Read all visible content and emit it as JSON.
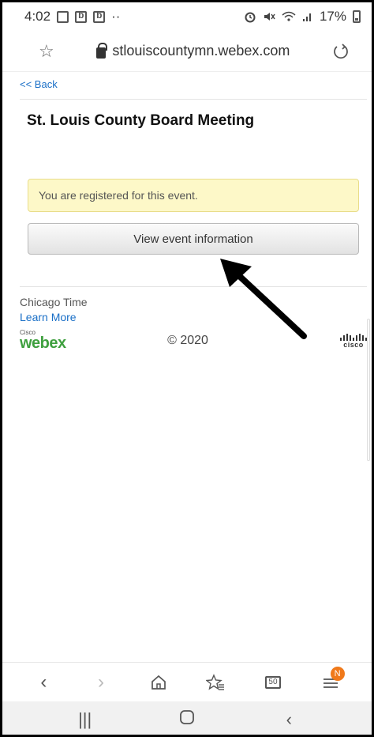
{
  "status_bar": {
    "time": "4:02",
    "more": "··",
    "battery": "17%"
  },
  "url_bar": {
    "url": "stlouiscountymn.webex.com",
    "bookmark_icon": "star-outline-icon",
    "reload_icon": "reload-icon"
  },
  "page": {
    "back_label": "<< Back",
    "title": "St. Louis County Board Meeting",
    "notice": "You are registered for this event.",
    "view_button": "View event information",
    "timezone": "Chicago Time",
    "learn_more": "Learn More",
    "copyright": "© 2020",
    "webex_small": "Cisco",
    "webex_word": "webex",
    "cisco_word": "cisco"
  },
  "toolbar": {
    "badge": "N",
    "tab_count": "50"
  },
  "colors": {
    "link": "#1a6fc7",
    "notice_bg": "#fdf8c8",
    "webex_green": "#3fa03f",
    "badge": "#f0791a"
  }
}
